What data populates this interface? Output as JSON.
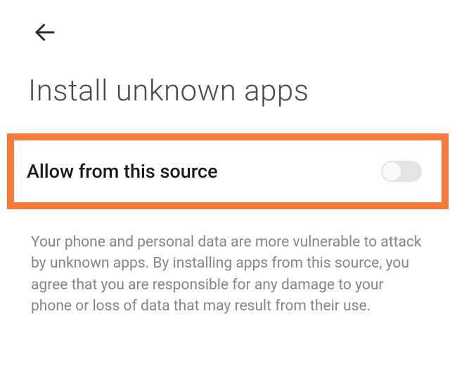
{
  "header": {
    "title": "Install unknown apps"
  },
  "setting": {
    "label": "Allow from this source",
    "enabled": false
  },
  "warning": {
    "text": "Your phone and personal data are more vulnerable to attack by unknown apps. By installing apps from this source, you agree that you are responsible for any damage to your phone or loss of data that may result from their use."
  },
  "highlight": {
    "color": "#f47b3e"
  }
}
